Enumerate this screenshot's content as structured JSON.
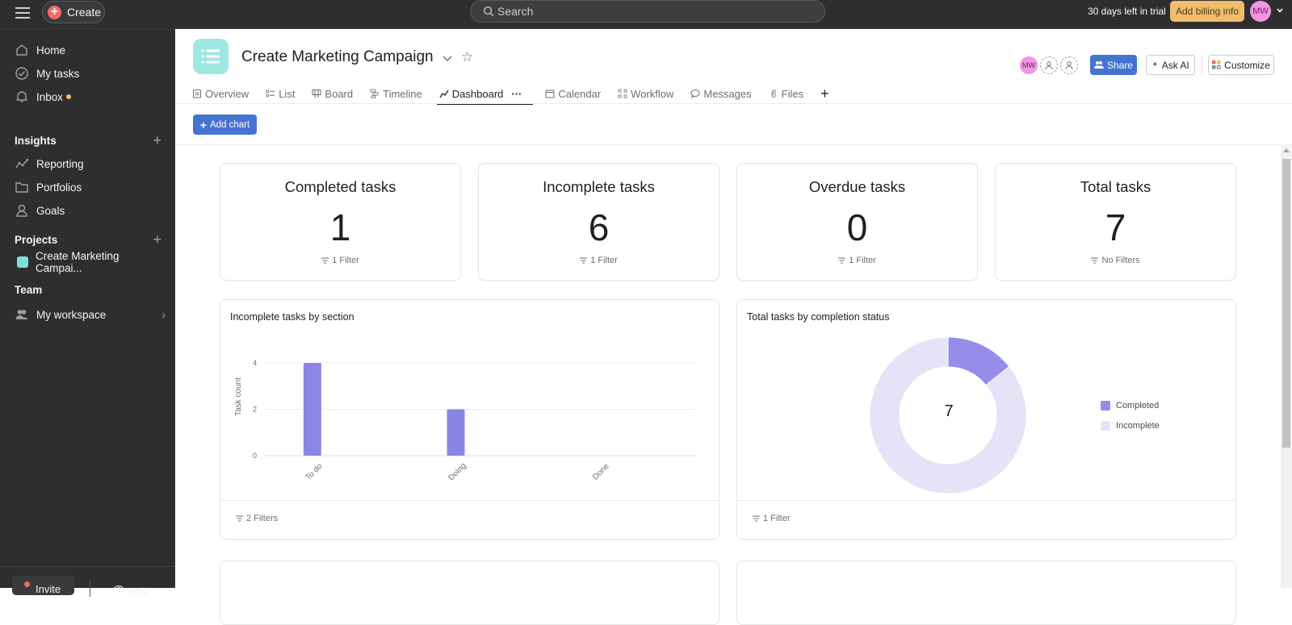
{
  "topbar": {
    "create_label": "Create",
    "search_placeholder": "Search",
    "trial_text": "30 days left in trial",
    "billing_label": "Add billing info",
    "user_initials": "MW"
  },
  "sidebar": {
    "nav": [
      {
        "label": "Home",
        "icon": "home-icon"
      },
      {
        "label": "My tasks",
        "icon": "check-circle-icon"
      },
      {
        "label": "Inbox",
        "icon": "bell-icon",
        "has_dot": true
      }
    ],
    "insights": {
      "header": "Insights",
      "items": [
        {
          "label": "Reporting",
          "icon": "line-chart-icon"
        },
        {
          "label": "Portfolios",
          "icon": "folder-icon"
        },
        {
          "label": "Goals",
          "icon": "person-icon"
        }
      ]
    },
    "projects": {
      "header": "Projects",
      "items": [
        {
          "label": "Create Marketing Campai...",
          "color": "#7fe0d4"
        }
      ]
    },
    "team": {
      "header": "Team",
      "items": [
        {
          "label": "My workspace",
          "icon": "people-icon"
        }
      ]
    },
    "invite_label": "Invite",
    "help_label": "Help"
  },
  "project": {
    "title": "Create Marketing Campaign",
    "icon_color": "#9ee7e3",
    "member_initials": "MW",
    "share_label": "Share",
    "askai_label": "Ask AI",
    "customize_label": "Customize",
    "tabs": [
      {
        "label": "Overview",
        "icon": "overview-icon"
      },
      {
        "label": "List",
        "icon": "list-icon"
      },
      {
        "label": "Board",
        "icon": "board-icon"
      },
      {
        "label": "Timeline",
        "icon": "timeline-icon"
      },
      {
        "label": "Dashboard",
        "icon": "dashboard-icon",
        "active": true
      },
      {
        "label": "Calendar",
        "icon": "calendar-icon"
      },
      {
        "label": "Workflow",
        "icon": "workflow-icon"
      },
      {
        "label": "Messages",
        "icon": "message-icon"
      },
      {
        "label": "Files",
        "icon": "paperclip-icon"
      }
    ],
    "add_chart_label": "Add chart"
  },
  "stats": [
    {
      "title": "Completed tasks",
      "value": "1",
      "filter": "1 Filter"
    },
    {
      "title": "Incomplete tasks",
      "value": "6",
      "filter": "1 Filter"
    },
    {
      "title": "Overdue tasks",
      "value": "0",
      "filter": "1 Filter"
    },
    {
      "title": "Total tasks",
      "value": "7",
      "filter": "No Filters"
    }
  ],
  "chart_data": [
    {
      "type": "bar",
      "title": "Incomplete tasks by section",
      "categories": [
        "To do",
        "Doing",
        "Done"
      ],
      "values": [
        4,
        2,
        0
      ],
      "xlabel": "",
      "ylabel": "Task count",
      "ylim": [
        0,
        4
      ],
      "yticks": [
        "0",
        "2",
        "4"
      ],
      "grid": true,
      "color": "#8d84e8",
      "filter": "2 Filters"
    },
    {
      "type": "pie",
      "title": "Total tasks by completion status",
      "donut": true,
      "center_label": "7",
      "slices": [
        {
          "label": "Completed",
          "value": 1,
          "color": "#958de8"
        },
        {
          "label": "Incomplete",
          "value": 6,
          "color": "#e6e3f8"
        }
      ],
      "legend": "right",
      "filter": "1 Filter"
    }
  ]
}
